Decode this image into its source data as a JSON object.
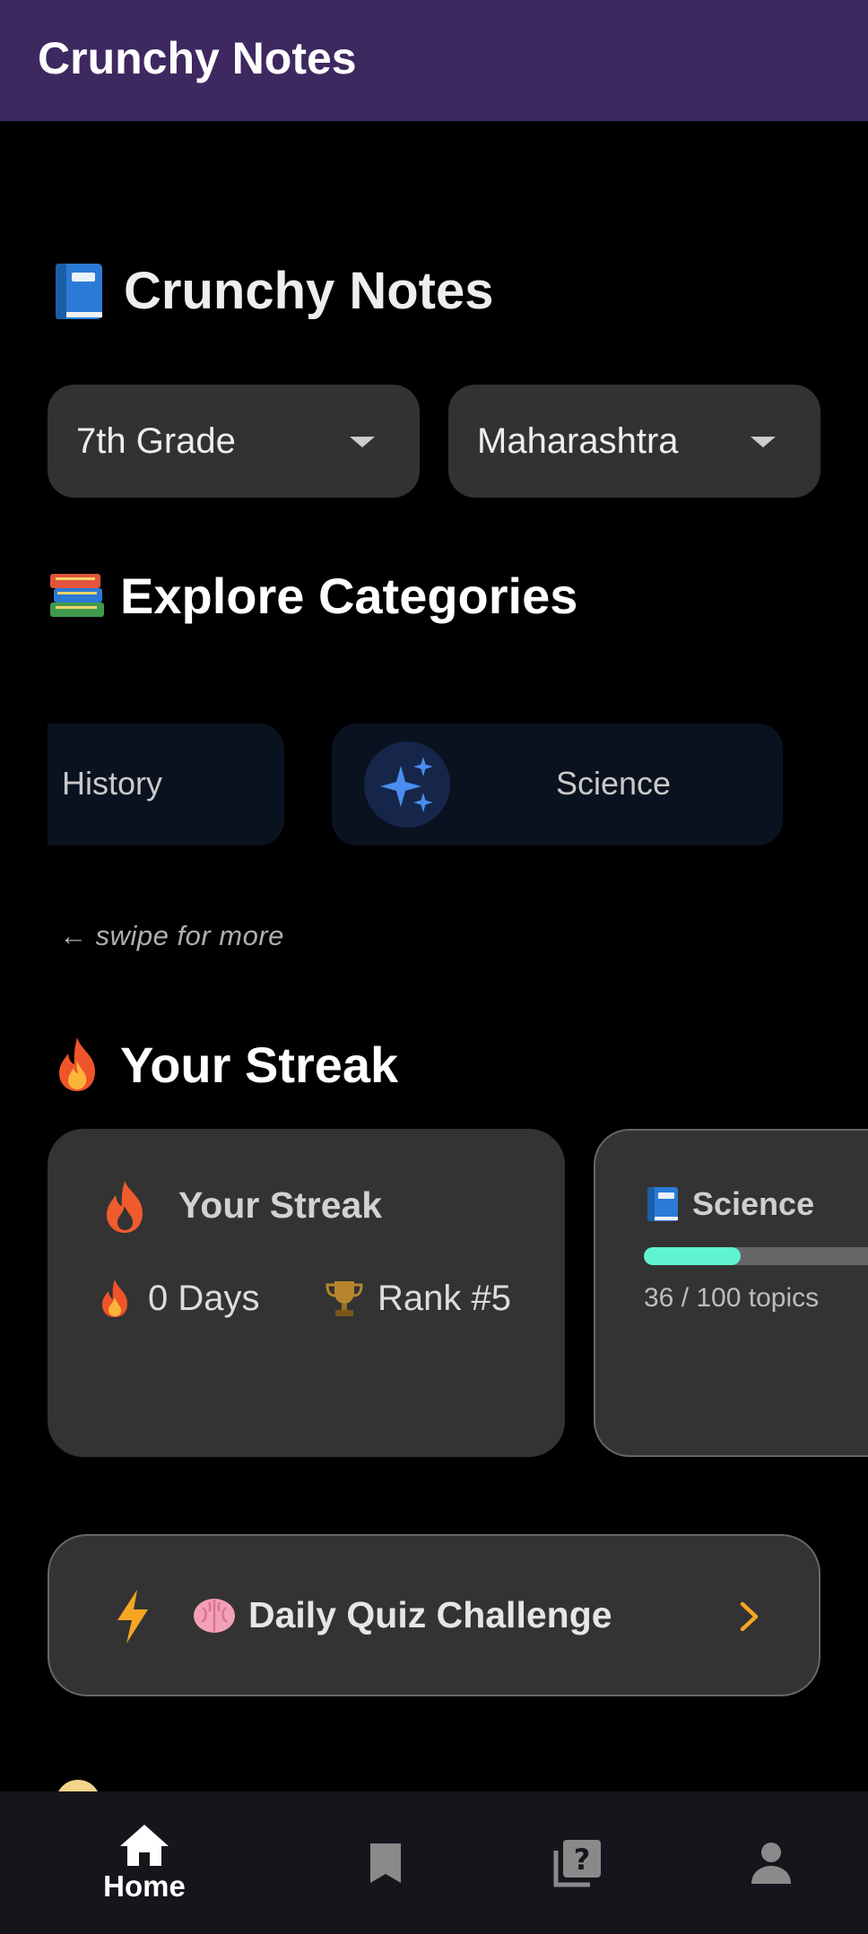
{
  "app_bar": {
    "title": "Crunchy Notes"
  },
  "heading": {
    "text": "Crunchy Notes"
  },
  "filters": {
    "grade": {
      "selected": "7th Grade"
    },
    "state": {
      "selected": "Maharashtra"
    }
  },
  "categories": {
    "title": "Explore Categories",
    "items": [
      {
        "label": "History"
      },
      {
        "label": "Science",
        "icon": "sparkles-icon"
      }
    ],
    "hint": "← swipe for more"
  },
  "streak": {
    "section_title": "Your Streak",
    "card_title": "Your Streak",
    "days": "0 Days",
    "rank": "Rank #5"
  },
  "progress": {
    "subject": "Science",
    "completed": 36,
    "total": 100,
    "count_text": "36 / 100 topics"
  },
  "quiz": {
    "label": "Daily Quiz Challenge"
  },
  "bottom_nav": {
    "items": [
      {
        "label": "Home",
        "icon": "home-icon",
        "active": true
      },
      {
        "label": "",
        "icon": "bookmark-icon"
      },
      {
        "label": "",
        "icon": "quiz-icon"
      },
      {
        "label": "",
        "icon": "profile-icon"
      }
    ]
  },
  "colors": {
    "app_bar": "#3e2860",
    "card": "#333333",
    "progress_fill": "#5ff3cf",
    "accent_orange": "#f5a623"
  }
}
